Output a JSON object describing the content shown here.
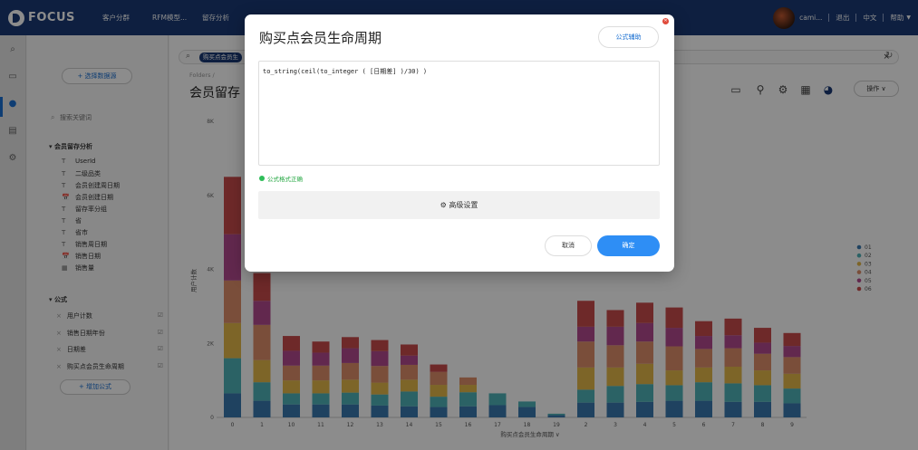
{
  "topbar": {
    "logo_text": "FOCUS",
    "nav": [
      "客户分群",
      "RFM模型...",
      "留存分析",
      "☑"
    ],
    "user": "cami...",
    "logout": "退出",
    "language": "中文",
    "help": "帮助"
  },
  "iconbar": {
    "icons": [
      "search-icon",
      "message-icon",
      "help-icon",
      "report-icon",
      "settings-icon"
    ]
  },
  "leftpanel": {
    "select_source": "+ 选择数据源",
    "search_placeholder": "搜索关键词",
    "section1": "会员留存分析",
    "fields": [
      {
        "icon": "T",
        "label": "UserId"
      },
      {
        "icon": "T",
        "label": "二级品类"
      },
      {
        "icon": "T",
        "label": "会员创建周日期"
      },
      {
        "icon": "📅",
        "label": "会员创建日期"
      },
      {
        "icon": "T",
        "label": "留存率分组"
      },
      {
        "icon": "T",
        "label": "省"
      },
      {
        "icon": "T",
        "label": "省市"
      },
      {
        "icon": "T",
        "label": "销售周日期"
      },
      {
        "icon": "📅",
        "label": "销售日期"
      },
      {
        "icon": "▦",
        "label": "销售量"
      }
    ],
    "section2": "公式",
    "formulas": [
      "用户计数",
      "销售日期年份",
      "日期差",
      "购买点会员生命周期"
    ],
    "add_formula": "+ 增加公式"
  },
  "main": {
    "search_tag": "购买点会员生",
    "breadcrumb": "Folders /",
    "title": "会员留存",
    "ops_label": "操作 ∨"
  },
  "chart_data": {
    "type": "bar",
    "stacked": true,
    "categories": [
      "0",
      "1",
      "10",
      "11",
      "12",
      "13",
      "14",
      "15",
      "16",
      "17",
      "18",
      "19",
      "2",
      "3",
      "4",
      "5",
      "6",
      "7",
      "8",
      "9"
    ],
    "ylabel": "用户计数",
    "xlabel": "购买点会员生命周期",
    "ylim": [
      0,
      8000
    ],
    "yticks": [
      "0",
      "2K",
      "4K",
      "6K",
      "8K"
    ],
    "series": [
      {
        "name": "01",
        "color": "#3a78b0",
        "values": [
          650,
          450,
          350,
          350,
          350,
          320,
          300,
          280,
          300,
          330,
          280,
          60,
          400,
          400,
          420,
          450,
          450,
          420,
          420,
          380
        ]
      },
      {
        "name": "02",
        "color": "#4fb3b9",
        "values": [
          950,
          500,
          300,
          300,
          320,
          300,
          400,
          280,
          380,
          320,
          150,
          40,
          350,
          450,
          480,
          420,
          500,
          500,
          450,
          400
        ]
      },
      {
        "name": "03",
        "color": "#e4b84a",
        "values": [
          950,
          600,
          350,
          350,
          350,
          320,
          320,
          320,
          200,
          0,
          0,
          0,
          600,
          500,
          550,
          400,
          400,
          450,
          400,
          400
        ]
      },
      {
        "name": "04",
        "color": "#df8e6b",
        "values": [
          1150,
          950,
          400,
          400,
          450,
          450,
          400,
          350,
          200,
          0,
          0,
          0,
          700,
          600,
          600,
          650,
          500,
          500,
          450,
          450
        ]
      },
      {
        "name": "05",
        "color": "#b24a8e",
        "values": [
          1250,
          650,
          400,
          350,
          400,
          400,
          250,
          0,
          0,
          0,
          0,
          0,
          400,
          500,
          500,
          500,
          350,
          350,
          300,
          300
        ]
      },
      {
        "name": "06",
        "color": "#c94b4b",
        "values": [
          1550,
          750,
          400,
          300,
          300,
          300,
          300,
          200,
          0,
          0,
          0,
          0,
          700,
          450,
          550,
          550,
          400,
          450,
          400,
          350
        ]
      }
    ],
    "legend_position": "right"
  },
  "modal": {
    "title": "购买点会员生命周期",
    "help_button": "公式辅助",
    "formula": "to_string(ceil(to_integer ( [日期差] )/30) )",
    "valid_message": "公式格式正确",
    "advanced_label": "高级设置",
    "cancel_label": "取消",
    "confirm_label": "确定"
  }
}
